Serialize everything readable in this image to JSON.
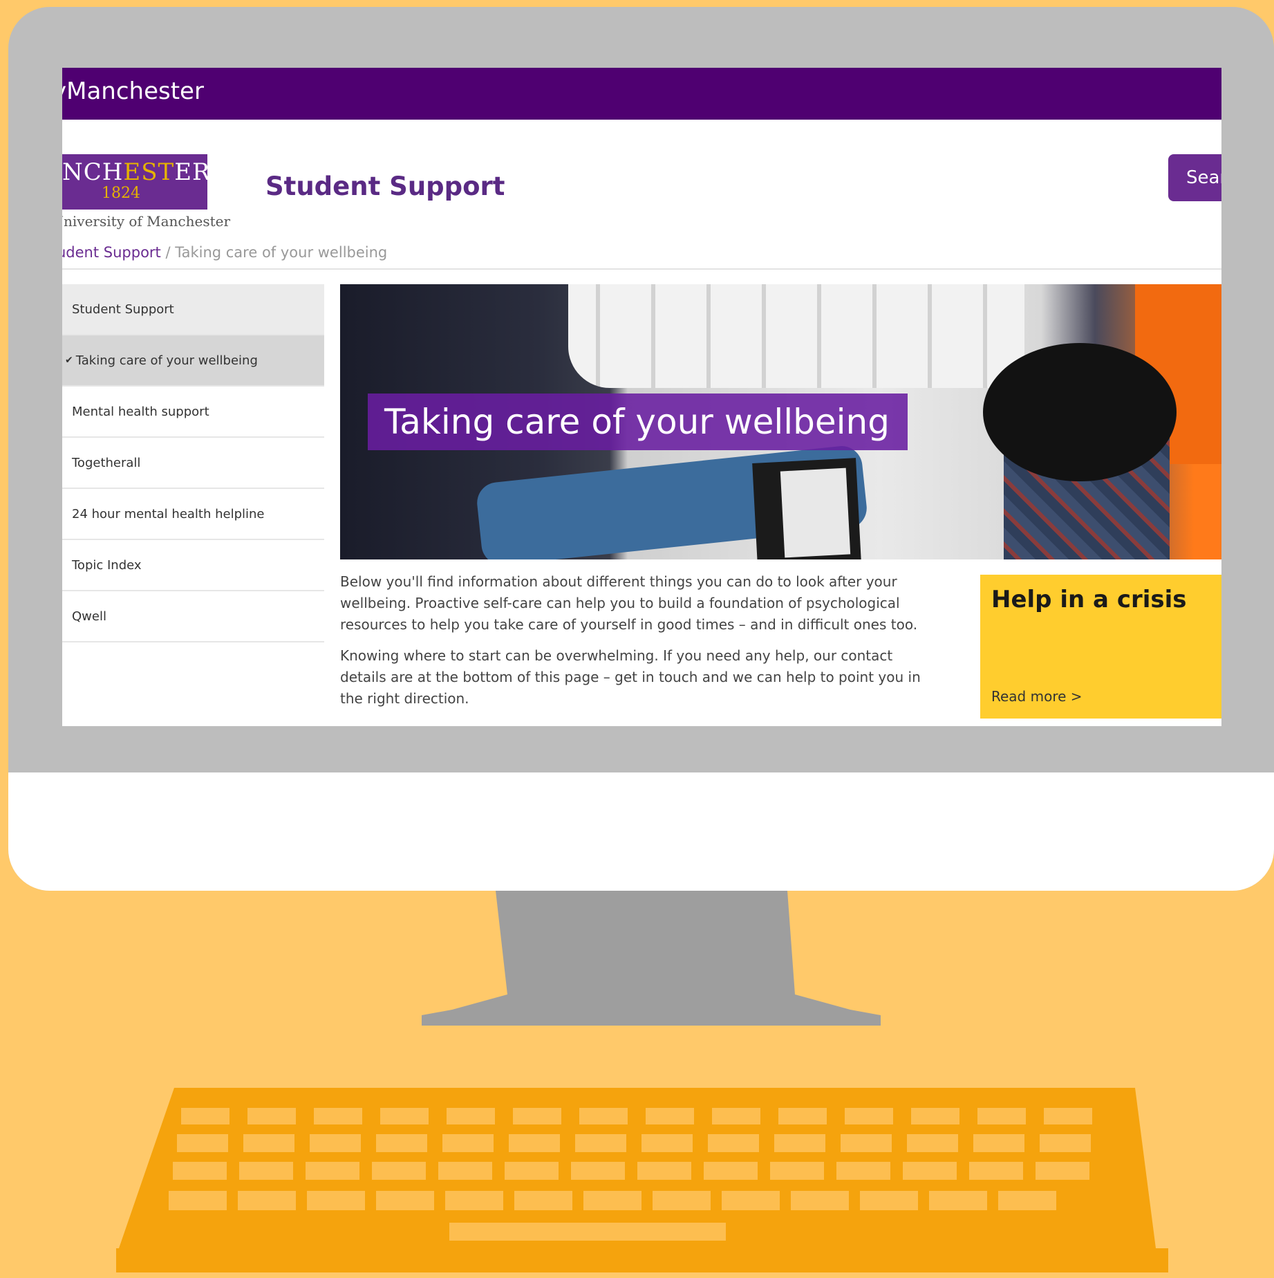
{
  "site": {
    "name": "yManchester"
  },
  "logo": {
    "word_start": "IANCH",
    "word_accent": "EST",
    "word_end": "ER",
    "year": "1824",
    "caption": "Jniversity of Manchester"
  },
  "header": {
    "section_title": "Student Support",
    "search_label": "Searc"
  },
  "breadcrumb": {
    "link": "udent Support",
    "separator": " / ",
    "current": "Taking care of your wellbeing"
  },
  "sidebar": {
    "items": [
      {
        "label": "Student Support"
      },
      {
        "label": "Taking care of your wellbeing",
        "active": true
      },
      {
        "label": "Mental health support"
      },
      {
        "label": "Togetherall"
      },
      {
        "label": "24 hour mental health helpline"
      },
      {
        "label": "Topic Index"
      },
      {
        "label": "Qwell"
      }
    ]
  },
  "hero": {
    "title": "Taking care of your wellbeing"
  },
  "content": {
    "paragraph1": "Below you'll find information about different things you can do to look after your wellbeing. Proactive self-care can help you to build a foundation of psychological resources to help you take care of yourself in good times – and in difficult ones too.",
    "paragraph2": "Knowing where to start can be overwhelming. If you need any help, our contact details are at the bottom of this page – get in touch and we can help to point you in the right direction."
  },
  "crisis_box": {
    "title": "Help in a crisis",
    "link": "Read more >"
  },
  "colors": {
    "background": "#ffc96a",
    "brand_purple": "#4f0071",
    "accent_purple": "#6a2c91",
    "crisis_yellow": "#ffcd2e",
    "keyboard_orange": "#f5a30d"
  }
}
